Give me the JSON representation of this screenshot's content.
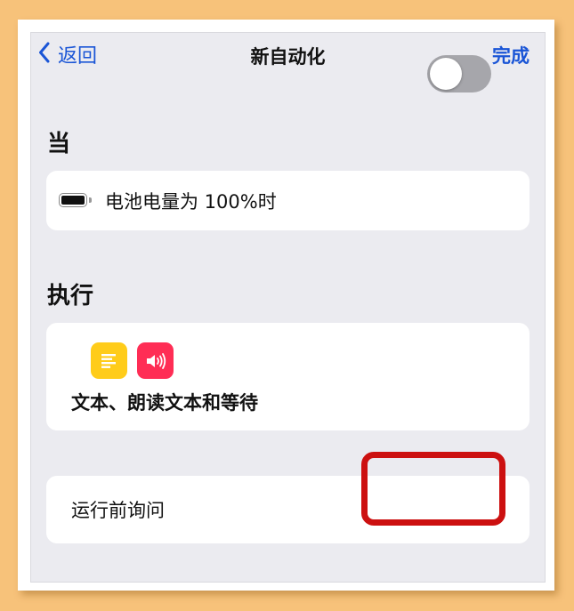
{
  "nav": {
    "back_label": "返回",
    "title": "新自动化",
    "done_label": "完成"
  },
  "when_section": {
    "title": "当",
    "trigger_text": "电池电量为 100%时",
    "trigger_icon": "battery-full-icon"
  },
  "do_section": {
    "title": "执行",
    "app_icons": [
      "text-icon",
      "speak-text-icon"
    ],
    "actions_text": "文本、朗读文本和等待"
  },
  "ask_before_running": {
    "label": "运行前询问",
    "enabled": false
  },
  "colors": {
    "accent": "#1a55d6",
    "background": "#ebebf0",
    "toggle_off": "#a6a6ab",
    "highlight_border": "#cc1010",
    "outer_background": "#f7c27a"
  }
}
